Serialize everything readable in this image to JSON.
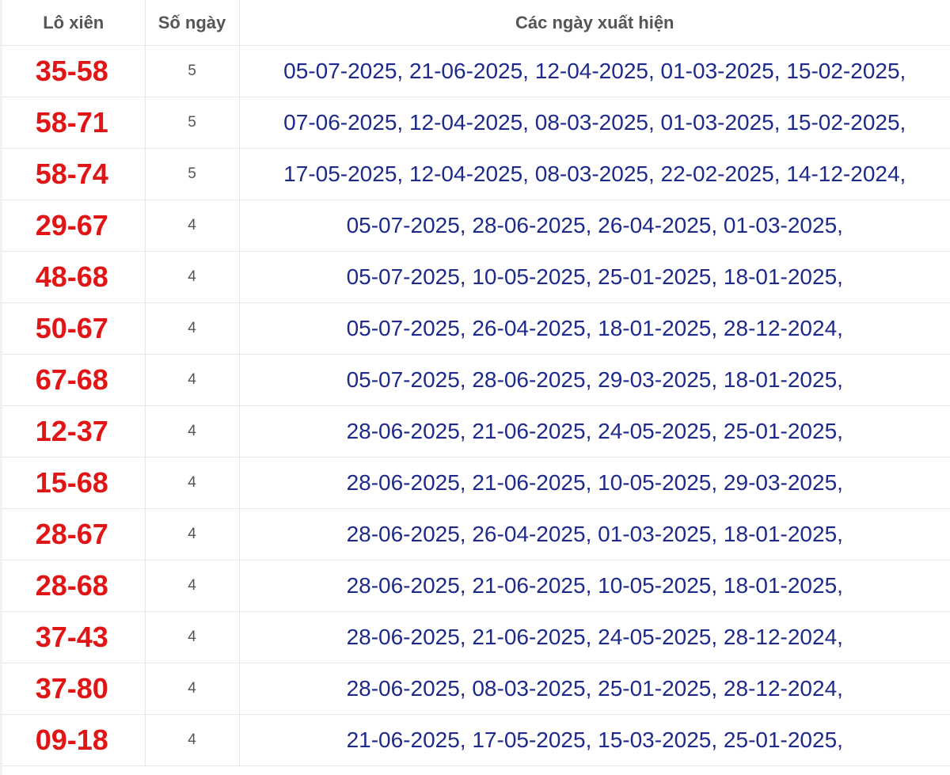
{
  "table": {
    "headers": {
      "pair": "Lô xiên",
      "count": "Số ngày",
      "dates": "Các ngày xuất hiện"
    },
    "rows": [
      {
        "pair": "35-58",
        "count": "5",
        "dates": "05-07-2025, 21-06-2025, 12-04-2025, 01-03-2025, 15-02-2025,"
      },
      {
        "pair": "58-71",
        "count": "5",
        "dates": "07-06-2025, 12-04-2025, 08-03-2025, 01-03-2025, 15-02-2025,"
      },
      {
        "pair": "58-74",
        "count": "5",
        "dates": "17-05-2025, 12-04-2025, 08-03-2025, 22-02-2025, 14-12-2024,"
      },
      {
        "pair": "29-67",
        "count": "4",
        "dates": "05-07-2025, 28-06-2025, 26-04-2025, 01-03-2025,"
      },
      {
        "pair": "48-68",
        "count": "4",
        "dates": "05-07-2025, 10-05-2025, 25-01-2025, 18-01-2025,"
      },
      {
        "pair": "50-67",
        "count": "4",
        "dates": "05-07-2025, 26-04-2025, 18-01-2025, 28-12-2024,"
      },
      {
        "pair": "67-68",
        "count": "4",
        "dates": "05-07-2025, 28-06-2025, 29-03-2025, 18-01-2025,"
      },
      {
        "pair": "12-37",
        "count": "4",
        "dates": "28-06-2025, 21-06-2025, 24-05-2025, 25-01-2025,"
      },
      {
        "pair": "15-68",
        "count": "4",
        "dates": "28-06-2025, 21-06-2025, 10-05-2025, 29-03-2025,"
      },
      {
        "pair": "28-67",
        "count": "4",
        "dates": "28-06-2025, 26-04-2025, 01-03-2025, 18-01-2025,"
      },
      {
        "pair": "28-68",
        "count": "4",
        "dates": "28-06-2025, 21-06-2025, 10-05-2025, 18-01-2025,"
      },
      {
        "pair": "37-43",
        "count": "4",
        "dates": "28-06-2025, 21-06-2025, 24-05-2025, 28-12-2024,"
      },
      {
        "pair": "37-80",
        "count": "4",
        "dates": "28-06-2025, 08-03-2025, 25-01-2025, 28-12-2024,"
      },
      {
        "pair": "09-18",
        "count": "4",
        "dates": "21-06-2025, 17-05-2025, 15-03-2025, 25-01-2025,"
      }
    ]
  },
  "colors": {
    "pair_text": "#e01515",
    "dates_text": "#1d2a8c",
    "header_text": "#555555",
    "border": "#e6e6e6"
  }
}
